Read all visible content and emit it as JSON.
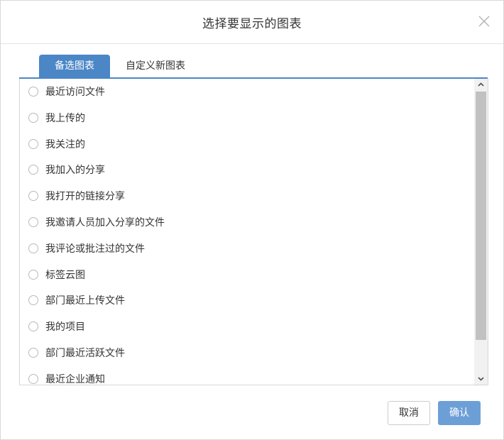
{
  "dialog": {
    "title": "选择要显示的图表",
    "tabs": [
      {
        "label": "备选图表",
        "active": true
      },
      {
        "label": "自定义新图表",
        "active": false
      }
    ],
    "items": [
      {
        "label": "最近访问文件"
      },
      {
        "label": "我上传的"
      },
      {
        "label": "我关注的"
      },
      {
        "label": "我加入的分享"
      },
      {
        "label": "我打开的链接分享"
      },
      {
        "label": "我邀请人员加入分享的文件"
      },
      {
        "label": "我评论或批注过的文件"
      },
      {
        "label": "标签云图"
      },
      {
        "label": "部门最近上传文件"
      },
      {
        "label": "我的项目"
      },
      {
        "label": "部门最近活跃文件"
      },
      {
        "label": "最近企业通知"
      }
    ],
    "buttons": {
      "cancel": "取消",
      "confirm": "确认"
    }
  },
  "colors": {
    "accent": "#4b86c6",
    "confirm": "#6d9fd7"
  }
}
